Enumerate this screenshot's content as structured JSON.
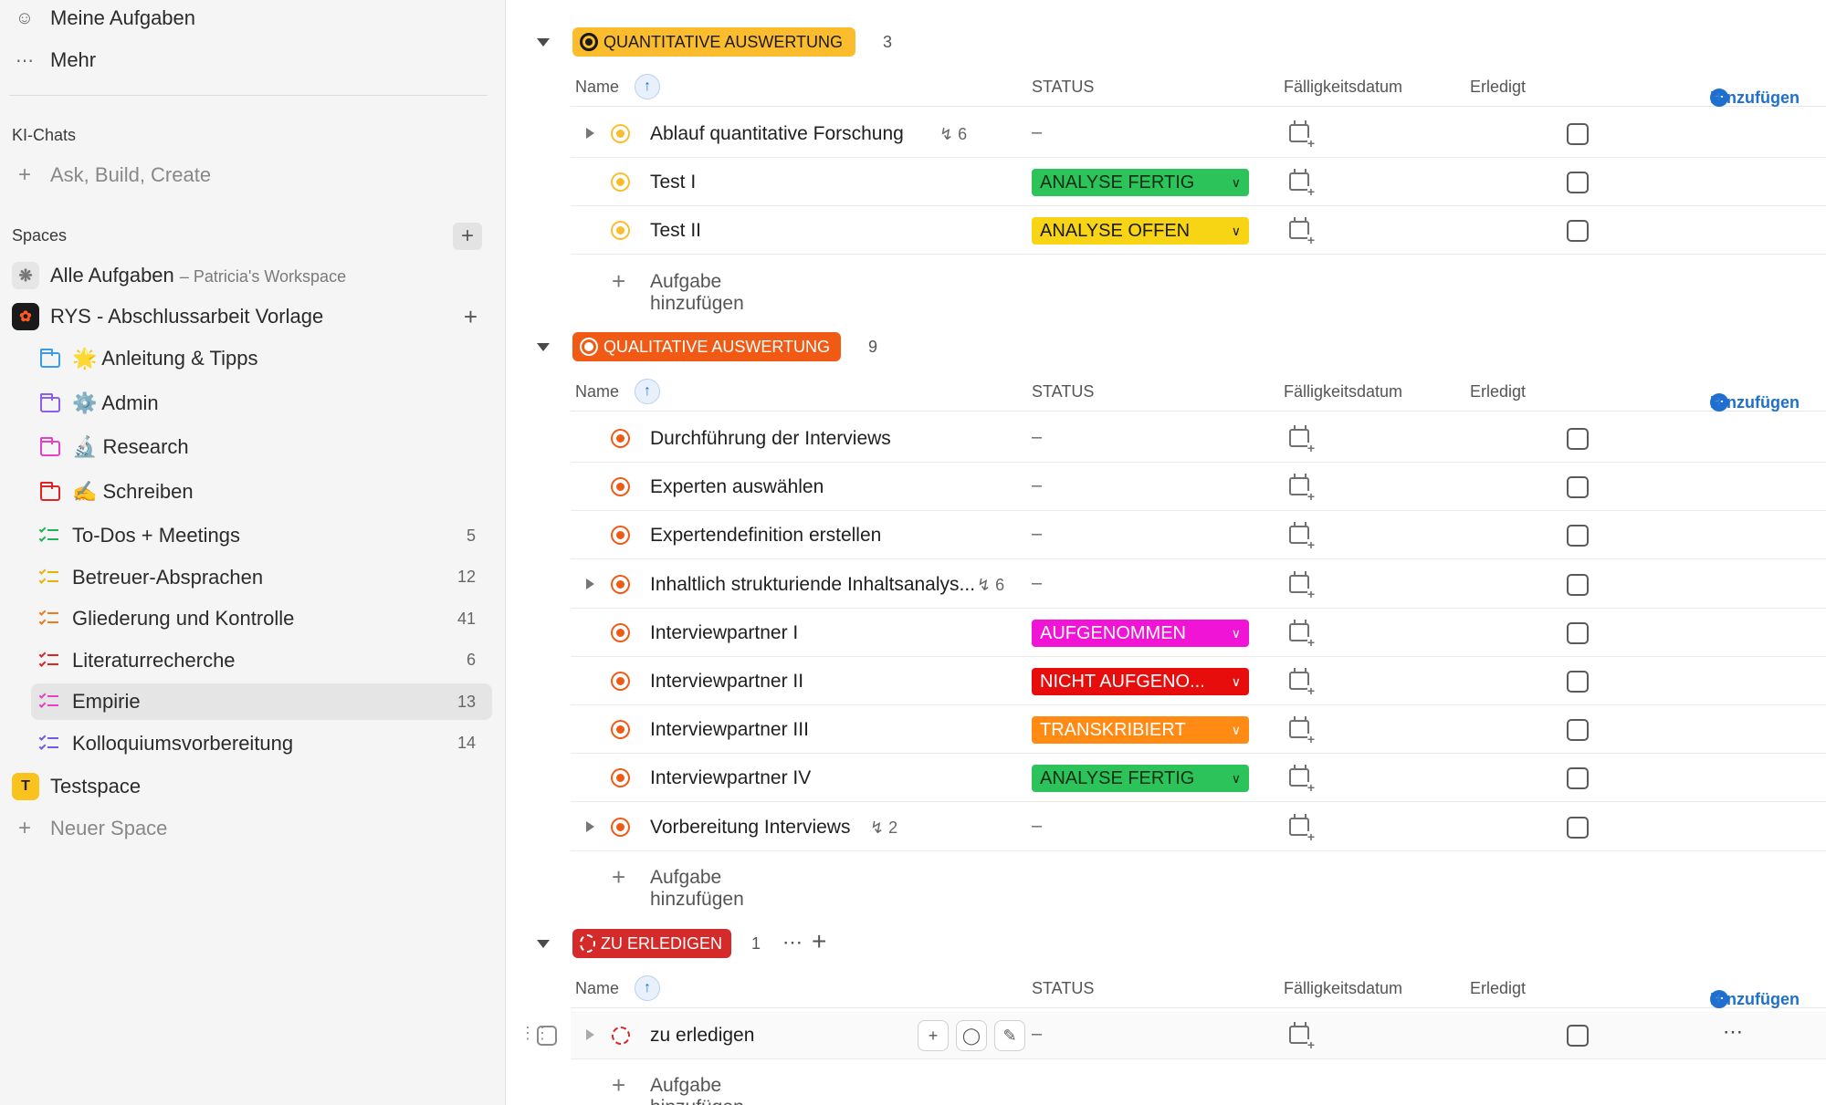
{
  "sidebar": {
    "my_tasks": "Meine Aufgaben",
    "more": "Mehr",
    "ai_chats_heading": "KI-Chats",
    "ai_chats_placeholder": "Ask, Build, Create",
    "spaces_heading": "Spaces",
    "all_tasks": "Alle Aufgaben",
    "all_tasks_sub": "– Patricia's Workspace",
    "space_rys": "RYS - Abschlussarbeit Vorlage",
    "folders": [
      {
        "label": "🌟 Anleitung & Tipps",
        "color": "#3a9be6"
      },
      {
        "label": "⚙️ Admin",
        "color": "#8b5cf6"
      },
      {
        "label": "🔬 Research",
        "color": "#e83fc8"
      },
      {
        "label": "✍️ Schreiben",
        "color": "#e02424"
      }
    ],
    "lists": [
      {
        "label": "To-Dos + Meetings",
        "count": "5",
        "color": "#22b35a"
      },
      {
        "label": "Betreuer-Absprachen",
        "count": "12",
        "color": "#e8b20a"
      },
      {
        "label": "Gliederung und Kontrolle",
        "count": "41",
        "color": "#f07a1a"
      },
      {
        "label": "Literaturrecherche",
        "count": "6",
        "color": "#e02424"
      },
      {
        "label": "Empirie",
        "count": "13",
        "color": "#e83fc8"
      },
      {
        "label": "Kolloquiumsvorbereitung",
        "count": "14",
        "color": "#6c5ce7"
      }
    ],
    "testspace_logo": "T",
    "testspace": "Testspace",
    "new_space": "Neuer Space"
  },
  "columns": {
    "name": "Name",
    "status": "STATUS",
    "due": "Fälligkeitsdatum",
    "done": "Erledigt",
    "add": "Hinzufügen"
  },
  "add_task": "Aufgabe hinzufügen",
  "groups": [
    {
      "label": "QUANTITATIVE AUSWERTUNG",
      "count": "3",
      "color": "#fbbd2e",
      "tasks": [
        {
          "name": "Ablauf quantitative Forschung",
          "subtasks": "6",
          "status": "–"
        },
        {
          "name": "Test I",
          "status": "ANALYSE FERTIG"
        },
        {
          "name": "Test II",
          "status": "ANALYSE OFFEN"
        }
      ]
    },
    {
      "label": "QUALITATIVE AUSWERTUNG",
      "count": "9",
      "color": "#f05a14",
      "tasks": [
        {
          "name": "Durchführung der Interviews",
          "status": "–"
        },
        {
          "name": "Experten auswählen",
          "status": "–"
        },
        {
          "name": "Expertendefinition erstellen",
          "status": "–"
        },
        {
          "name": "Inhaltlich strukturiende Inhaltsanalys...",
          "subtasks": "6",
          "status": "–"
        },
        {
          "name": "Interviewpartner I",
          "status": "AUFGENOMMEN"
        },
        {
          "name": "Interviewpartner II",
          "status": "NICHT AUFGENO..."
        },
        {
          "name": "Interviewpartner III",
          "status": "TRANSKRIBIERT"
        },
        {
          "name": "Interviewpartner IV",
          "status": "ANALYSE FERTIG"
        },
        {
          "name": "Vorbereitung Interviews",
          "subtasks": "2",
          "status": "–"
        }
      ]
    },
    {
      "label": "ZU ERLEDIGEN",
      "count": "1",
      "color": "#d42a2a",
      "tasks": [
        {
          "name": "zu erledigen",
          "status": "–"
        }
      ]
    }
  ],
  "status_colors": {
    "ANALYSE FERTIG": "#2cc35a",
    "ANALYSE OFFEN": "#f8d514",
    "AUFGENOMMEN": "#ef14d6",
    "NICHT AUFGENO...": "#e80d0d",
    "TRANSKRIBIERT": "#ff8a14"
  }
}
